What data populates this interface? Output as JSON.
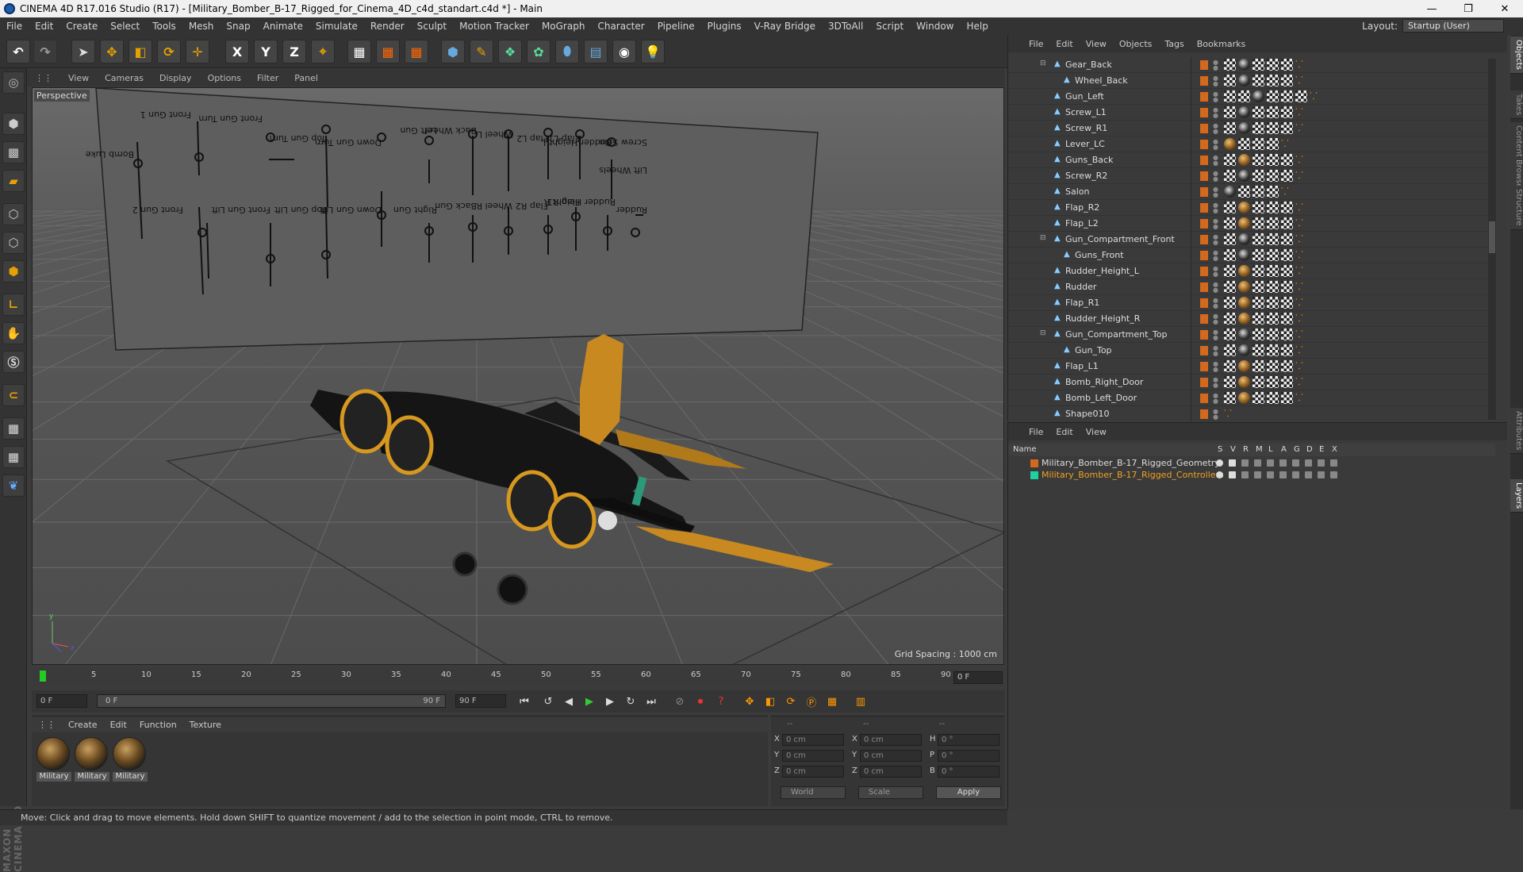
{
  "window": {
    "title": "CINEMA 4D R17.016 Studio (R17) - [Military_Bomber_B-17_Rigged_for_Cinema_4D_c4d_standart.c4d *] - Main",
    "minimize": "—",
    "restore": "❐",
    "close": "✕"
  },
  "menu": [
    "File",
    "Edit",
    "Create",
    "Select",
    "Tools",
    "Mesh",
    "Snap",
    "Animate",
    "Simulate",
    "Render",
    "Sculpt",
    "Motion Tracker",
    "MoGraph",
    "Character",
    "Pipeline",
    "Plugins",
    "V-Ray Bridge",
    "3DToAll",
    "Script",
    "Window",
    "Help"
  ],
  "layout": {
    "label": "Layout:",
    "value": "Startup (User)"
  },
  "toolbar": {
    "undo": "↶",
    "redo": "↷",
    "axis_x": "X",
    "axis_y": "Y",
    "axis_z": "Z"
  },
  "viewport": {
    "menu": [
      "View",
      "Cameras",
      "Display",
      "Options",
      "Filter",
      "Panel"
    ],
    "label": "Perspective",
    "grid_spacing": "Grid Spacing : 1000 cm",
    "controller_labels": [
      "Bomb Luke",
      "Front Gun 1",
      "Front Gun Turn",
      "Top Gun Turn",
      "Down Gun Turn",
      "Left Gun",
      "Back Wheel",
      "Wheel L",
      "Flap L2",
      "Flap L1",
      "Rudder Height L",
      "Screw Spin",
      "Lift Wheels",
      "Front Gun 2",
      "Front Gun Lift",
      "Top Gun Lift",
      "Down Gun Lift",
      "Right Gun",
      "Back Gun",
      "Wheel R",
      "Flap R2",
      "Flap R1",
      "Rudder Height R",
      "Rudder"
    ]
  },
  "timeline": {
    "ticks": [
      "0",
      "5",
      "10",
      "15",
      "20",
      "25",
      "30",
      "35",
      "40",
      "45",
      "50",
      "55",
      "60",
      "65",
      "70",
      "75",
      "80",
      "85",
      "90"
    ],
    "current_frame": "0 F"
  },
  "transport": {
    "start": "0 F",
    "range_start": "0 F",
    "range_end": "90 F",
    "end": "90 F"
  },
  "materials": {
    "menu": [
      "Create",
      "Edit",
      "Function",
      "Texture"
    ],
    "items": [
      "Military",
      "Military",
      "Military"
    ]
  },
  "coords": {
    "headers": [
      "--",
      "--",
      "--"
    ],
    "rows": [
      {
        "a": "X",
        "av": "0 cm",
        "b": "X",
        "bv": "0 cm",
        "c": "H",
        "cv": "0 °"
      },
      {
        "a": "Y",
        "av": "0 cm",
        "b": "Y",
        "bv": "0 cm",
        "c": "P",
        "cv": "0 °"
      },
      {
        "a": "Z",
        "av": "0 cm",
        "b": "Z",
        "bv": "0 cm",
        "c": "B",
        "cv": "0 °"
      }
    ],
    "world": "World",
    "scale": "Scale",
    "apply": "Apply"
  },
  "status": "Move: Click and drag to move elements. Hold down SHIFT to quantize movement / add to the selection in point mode, CTRL to remove.",
  "objects": {
    "menu": [
      "File",
      "Edit",
      "View",
      "Objects",
      "Tags",
      "Bookmarks"
    ],
    "rows": [
      {
        "name": "Gear_Back",
        "indent": 1,
        "tags": [
          "chk",
          "ball",
          "chk",
          "chk",
          "chk",
          "or"
        ]
      },
      {
        "name": "Wheel_Back",
        "indent": 2,
        "tags": [
          "chk",
          "ball",
          "chk",
          "chk",
          "chk",
          "or"
        ]
      },
      {
        "name": "Gun_Left",
        "indent": 1,
        "tags": [
          "chk",
          "chk",
          "ball",
          "chk",
          "chk",
          "chk",
          "or"
        ]
      },
      {
        "name": "Screw_L1",
        "indent": 1,
        "tags": [
          "chk",
          "ball",
          "chk",
          "chk",
          "chk",
          "or"
        ]
      },
      {
        "name": "Screw_R1",
        "indent": 1,
        "tags": [
          "chk",
          "ball",
          "chk",
          "chk",
          "chk",
          "or"
        ]
      },
      {
        "name": "Lever_LC",
        "indent": 1,
        "tags": [
          "gold",
          "chk",
          "chk",
          "chk",
          "or"
        ]
      },
      {
        "name": "Guns_Back",
        "indent": 1,
        "tags": [
          "chk",
          "gold",
          "chk",
          "chk",
          "chk",
          "or"
        ]
      },
      {
        "name": "Screw_R2",
        "indent": 1,
        "tags": [
          "chk",
          "ball",
          "chk",
          "chk",
          "chk",
          "or"
        ]
      },
      {
        "name": "Salon",
        "indent": 1,
        "tags": [
          "ball",
          "chk",
          "chk",
          "chk",
          "or"
        ]
      },
      {
        "name": "Flap_R2",
        "indent": 1,
        "tags": [
          "chk",
          "gold",
          "chk",
          "chk",
          "chk",
          "or"
        ]
      },
      {
        "name": "Flap_L2",
        "indent": 1,
        "tags": [
          "chk",
          "gold",
          "chk",
          "chk",
          "chk",
          "or"
        ]
      },
      {
        "name": "Gun_Compartment_Front",
        "indent": 1,
        "tags": [
          "chk",
          "ball",
          "chk",
          "chk",
          "chk",
          "or"
        ]
      },
      {
        "name": "Guns_Front",
        "indent": 2,
        "tags": [
          "chk",
          "ball",
          "chk",
          "chk",
          "chk",
          "or"
        ]
      },
      {
        "name": "Rudder_Height_L",
        "indent": 1,
        "tags": [
          "chk",
          "gold",
          "chk",
          "chk",
          "chk",
          "or"
        ]
      },
      {
        "name": "Rudder",
        "indent": 1,
        "tags": [
          "chk",
          "gold",
          "chk",
          "chk",
          "chk",
          "or"
        ]
      },
      {
        "name": "Flap_R1",
        "indent": 1,
        "tags": [
          "chk",
          "gold",
          "chk",
          "chk",
          "chk",
          "or"
        ]
      },
      {
        "name": "Rudder_Height_R",
        "indent": 1,
        "tags": [
          "chk",
          "gold",
          "chk",
          "chk",
          "chk",
          "or"
        ]
      },
      {
        "name": "Gun_Compartment_Top",
        "indent": 1,
        "tags": [
          "chk",
          "ball",
          "chk",
          "chk",
          "chk",
          "or"
        ]
      },
      {
        "name": "Gun_Top",
        "indent": 2,
        "tags": [
          "chk",
          "ball",
          "chk",
          "chk",
          "chk",
          "or"
        ]
      },
      {
        "name": "Flap_L1",
        "indent": 1,
        "tags": [
          "chk",
          "gold",
          "chk",
          "chk",
          "chk",
          "or"
        ]
      },
      {
        "name": "Bomb_Right_Door",
        "indent": 1,
        "tags": [
          "chk",
          "gold",
          "chk",
          "chk",
          "chk",
          "or"
        ]
      },
      {
        "name": "Bomb_Left_Door",
        "indent": 1,
        "tags": [
          "chk",
          "gold",
          "chk",
          "chk",
          "chk",
          "or"
        ]
      },
      {
        "name": "Shape010",
        "indent": 1,
        "tags": [
          "or"
        ]
      }
    ]
  },
  "layers": {
    "menu": [
      "File",
      "Edit",
      "View"
    ],
    "header": {
      "name": "Name",
      "cols": [
        "S",
        "V",
        "R",
        "M",
        "L",
        "A",
        "G",
        "D",
        "E",
        "X"
      ]
    },
    "rows": [
      {
        "name": "Military_Bomber_B-17_Rigged_Geometry",
        "color": "#d2691e",
        "text_color": "#dddddd"
      },
      {
        "name": "Military_Bomber_B-17_Rigged_Controllers",
        "color": "#1fd1a0",
        "text_color": "#f0a020"
      }
    ]
  },
  "right_tabs": [
    "Objects",
    "Takes",
    "Content Browser",
    "Structure",
    "Attributes",
    "Layers"
  ]
}
